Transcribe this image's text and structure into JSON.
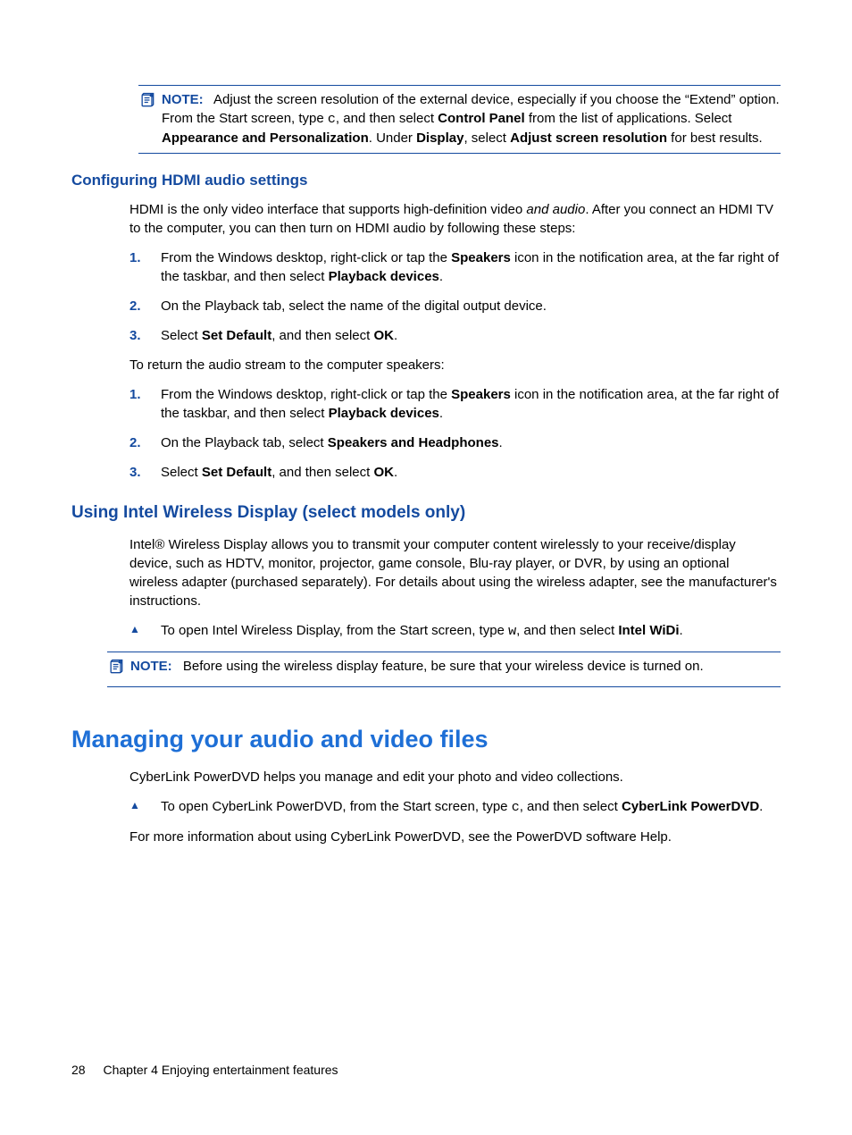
{
  "note1": {
    "label": "NOTE:",
    "runs": [
      {
        "t": "Adjust the screen resolution of the external device, especially if you choose the “Extend” option. From the Start screen, type "
      },
      {
        "t": "c",
        "cls": "mono"
      },
      {
        "t": ", and then select "
      },
      {
        "t": "Control Panel",
        "b": true
      },
      {
        "t": " from the list of applications. Select "
      },
      {
        "t": "Appearance and Personalization",
        "b": true
      },
      {
        "t": ". Under "
      },
      {
        "t": "Display",
        "b": true
      },
      {
        "t": ", select "
      },
      {
        "t": "Adjust screen resolution",
        "b": true
      },
      {
        "t": " for best results."
      }
    ]
  },
  "h3_1": "Configuring HDMI audio settings",
  "p1": {
    "runs": [
      {
        "t": "HDMI is the only video interface that supports high-definition video "
      },
      {
        "t": "and audio",
        "i": true
      },
      {
        "t": ". After you connect an HDMI TV to the computer, you can then turn on HDMI audio by following these steps:"
      }
    ]
  },
  "ol1": [
    {
      "runs": [
        {
          "t": "From the Windows desktop, right-click or tap the "
        },
        {
          "t": "Speakers",
          "b": true
        },
        {
          "t": " icon in the notification area, at the far right of the taskbar, and then select "
        },
        {
          "t": "Playback devices",
          "b": true
        },
        {
          "t": "."
        }
      ]
    },
    {
      "runs": [
        {
          "t": "On the Playback tab, select the name of the digital output device."
        }
      ]
    },
    {
      "runs": [
        {
          "t": "Select "
        },
        {
          "t": "Set Default",
          "b": true
        },
        {
          "t": ", and then select "
        },
        {
          "t": "OK",
          "b": true
        },
        {
          "t": "."
        }
      ]
    }
  ],
  "p2": "To return the audio stream to the computer speakers:",
  "ol2": [
    {
      "runs": [
        {
          "t": "From the Windows desktop, right-click or tap the "
        },
        {
          "t": "Speakers",
          "b": true
        },
        {
          "t": " icon in the notification area, at the far right of the taskbar, and then select "
        },
        {
          "t": "Playback devices",
          "b": true
        },
        {
          "t": "."
        }
      ]
    },
    {
      "runs": [
        {
          "t": "On the Playback tab, select "
        },
        {
          "t": "Speakers and Headphones",
          "b": true
        },
        {
          "t": "."
        }
      ]
    },
    {
      "runs": [
        {
          "t": "Select "
        },
        {
          "t": "Set Default",
          "b": true
        },
        {
          "t": ", and then select "
        },
        {
          "t": "OK",
          "b": true
        },
        {
          "t": "."
        }
      ]
    }
  ],
  "h2_1": "Using Intel Wireless Display (select models only)",
  "p3": "Intel® Wireless Display allows you to transmit your computer content wirelessly to your receive/display device, such as HDTV, monitor, projector, game console, Blu-ray player, or DVR, by using an optional wireless adapter (purchased separately). For details about using the wireless adapter, see the manufacturer's instructions.",
  "ul1": [
    {
      "runs": [
        {
          "t": "To open Intel Wireless Display, from the Start screen, type "
        },
        {
          "t": "w",
          "cls": "mono"
        },
        {
          "t": ", and then select "
        },
        {
          "t": "Intel WiDi",
          "b": true
        },
        {
          "t": "."
        }
      ]
    }
  ],
  "note2": {
    "label": "NOTE:",
    "text": "Before using the wireless display feature, be sure that your wireless device is turned on."
  },
  "h1_1": "Managing your audio and video files",
  "p4": "CyberLink PowerDVD helps you manage and edit your photo and video collections.",
  "ul2": [
    {
      "runs": [
        {
          "t": "To open CyberLink PowerDVD, from the Start screen, type "
        },
        {
          "t": "c",
          "cls": "mono"
        },
        {
          "t": ", and then select "
        },
        {
          "t": "CyberLink PowerDVD",
          "b": true
        },
        {
          "t": "."
        }
      ]
    }
  ],
  "p5": "For more information about using CyberLink PowerDVD, see the PowerDVD software Help.",
  "footer": {
    "page": "28",
    "chapter": "Chapter 4   Enjoying entertainment features"
  }
}
